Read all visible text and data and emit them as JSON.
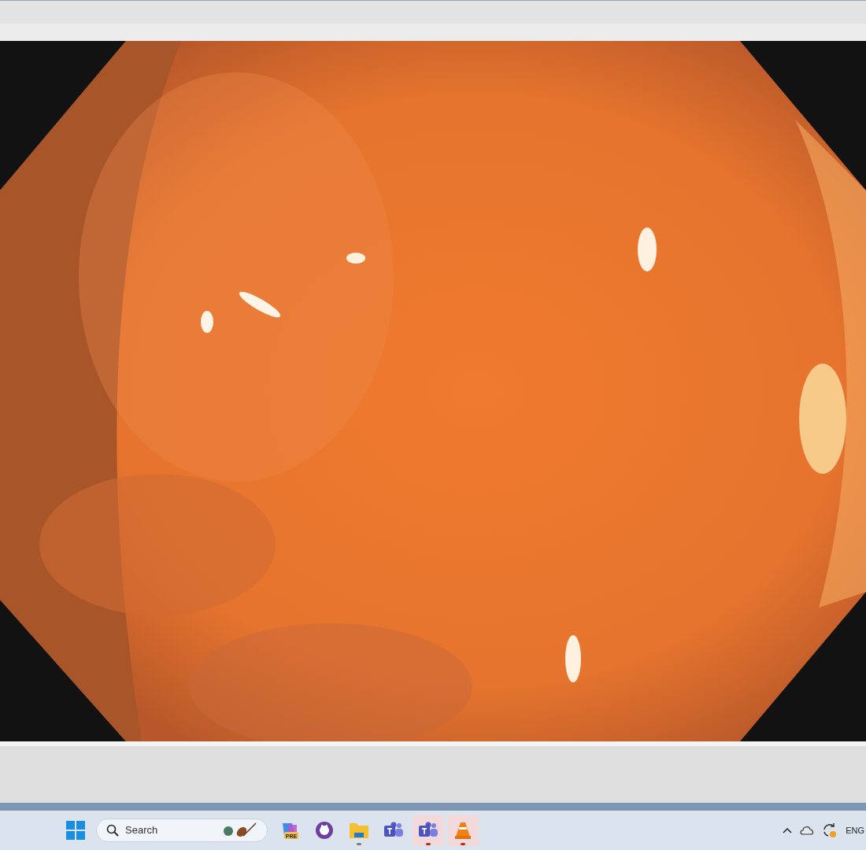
{
  "taskbar": {
    "search": {
      "placeholder": "Search"
    },
    "apps": [
      {
        "kind": "copilot",
        "badge": "PRE",
        "running": false,
        "attention": false
      },
      {
        "kind": "github",
        "running": false,
        "attention": false
      },
      {
        "kind": "folder",
        "running": true,
        "attention": false
      },
      {
        "kind": "teams",
        "running": false,
        "attention": false
      },
      {
        "kind": "teams",
        "running": true,
        "attention": true
      },
      {
        "kind": "cone",
        "running": true,
        "attention": true
      }
    ],
    "tray": {
      "language": "ENG"
    }
  }
}
